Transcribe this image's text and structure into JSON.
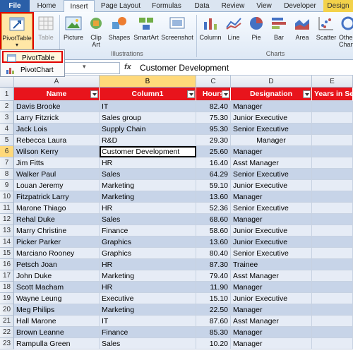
{
  "tabs": [
    "File",
    "Home",
    "Insert",
    "Page Layout",
    "Formulas",
    "Data",
    "Review",
    "View",
    "Developer",
    "Design"
  ],
  "ribbon": {
    "pivottable": "PivotTable",
    "table": "Table",
    "picture": "Picture",
    "clipart": "Clip Art",
    "shapes": "Shapes",
    "smartart": "SmartArt",
    "screenshot": "Screenshot",
    "column": "Column",
    "line": "Line",
    "pie": "Pie",
    "bar": "Bar",
    "area": "Area",
    "scatter": "Scatter",
    "other": "Other Charts",
    "group_illustrations": "Illustrations",
    "group_charts": "Charts"
  },
  "pivot_menu": {
    "item1": "PivotTable",
    "item2": "PivotChart"
  },
  "formula_bar": {
    "fx": "fx",
    "value": "Customer Development"
  },
  "column_letters": [
    "A",
    "B",
    "C",
    "D",
    "E"
  ],
  "headers": [
    "Name",
    "Column1",
    "Hours",
    "Designation",
    "Years in Se"
  ],
  "rows": [
    [
      "Davis Brooke",
      "IT",
      "82.40",
      "Manager"
    ],
    [
      "Larry Fitzrick",
      "Sales group",
      "75.30",
      "Junior Executive"
    ],
    [
      "Jack Lois",
      "Supply Chain",
      "95.30",
      "Senior Executive"
    ],
    [
      "Rebecca Laura",
      "R&D",
      "29.30",
      "Manager"
    ],
    [
      "Wilson Kerry",
      "Customer Development",
      "25.60",
      "Manager"
    ],
    [
      "Jim Fitts",
      "HR",
      "16.40",
      "Asst Manager"
    ],
    [
      "Walker Paul",
      "Sales",
      "64.29",
      "Senior Executive"
    ],
    [
      "Louan Jeremy",
      "Marketing",
      "59.10",
      "Junior Executive"
    ],
    [
      "Fitzpatrick Larry",
      "Marketing",
      "13.60",
      "Manager"
    ],
    [
      "Marone Thiago",
      "HR",
      "52.36",
      "Senior Executive"
    ],
    [
      "Rehal Duke",
      "Sales",
      "68.60",
      "Manager"
    ],
    [
      "Marry Christine",
      "Finance",
      "58.60",
      "Junior Executive"
    ],
    [
      "Picker Parker",
      "Graphics",
      "13.60",
      "Junior Executive"
    ],
    [
      "Marciano Rooney",
      "Graphics",
      "80.40",
      "Senior   Executive"
    ],
    [
      "Petsch Joan",
      "HR",
      "87.30",
      "Trainee"
    ],
    [
      "John Duke",
      "Marketing",
      "79.40",
      "Asst Manager"
    ],
    [
      "Scott Macham",
      "HR",
      "11.90",
      "Manager"
    ],
    [
      "Wayne Leung",
      "Executive",
      "15.10",
      "Junior Executive"
    ],
    [
      "Meg Philips",
      "Marketing",
      "22.50",
      "Manager"
    ],
    [
      "Hall Marone",
      "IT",
      "87.60",
      "Asst Manager"
    ],
    [
      "Brown Leanne",
      "Finance",
      "85.30",
      "Manager"
    ],
    [
      "Rampulla Green",
      "Sales",
      "10.20",
      "Manager"
    ]
  ],
  "row_numbers": [
    "1",
    "2",
    "3",
    "4",
    "5",
    "6",
    "7",
    "8",
    "9",
    "10",
    "11",
    "12",
    "13",
    "14",
    "15",
    "16",
    "17",
    "18",
    "19",
    "20",
    "21",
    "22",
    "23"
  ]
}
